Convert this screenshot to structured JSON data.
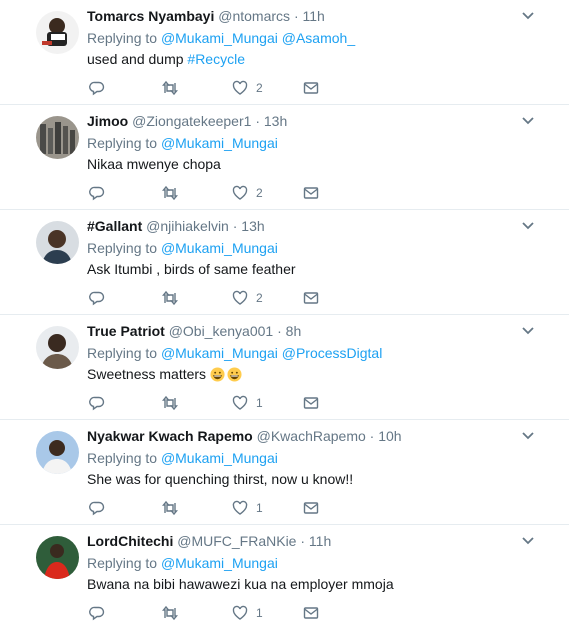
{
  "replying_to_label": "Replying to",
  "tweets": [
    {
      "name": "Tomarcs Nyambayi",
      "handle": "@ntomarcs",
      "time": "11h",
      "mentions": [
        "@Mukami_Mungai",
        "@Asamoh_"
      ],
      "text": "used and dump ",
      "hashtag": "#Recycle",
      "reply_count": "",
      "retweet_count": "",
      "like_count": "2"
    },
    {
      "name": "Jimoo",
      "handle": "@Ziongatekeeper1",
      "time": "13h",
      "mentions": [
        "@Mukami_Mungai"
      ],
      "text": "Nikaa mwenye chopa",
      "like_count": "2"
    },
    {
      "name": "#Gallant",
      "handle": "@njihiakelvin",
      "time": "13h",
      "mentions": [
        "@Mukami_Mungai"
      ],
      "text": "Ask Itumbi , birds of same feather",
      "like_count": "2"
    },
    {
      "name": "True Patriot",
      "handle": "@Obi_kenya001",
      "time": "8h",
      "mentions": [
        "@Mukami_Mungai",
        "@ProcessDigtal"
      ],
      "text": "Sweetness matters ",
      "emoji": "grinning-face-emoji",
      "like_count": "1"
    },
    {
      "name": "Nyakwar Kwach Rapemo",
      "handle": "@KwachRapemo",
      "time": "10h",
      "mentions": [
        "@Mukami_Mungai"
      ],
      "text": "She was for quenching thirst, now u know!!",
      "like_count": "1"
    },
    {
      "name": "LordChitechi",
      "handle": "@MUFC_FRaNKie",
      "time": "11h",
      "mentions": [
        "@Mukami_Mungai"
      ],
      "text": "Bwana na bibi hawawezi kua na employer mmoja",
      "like_count": "1"
    }
  ],
  "colors": {
    "link": "#1da1f2",
    "muted": "#657786",
    "text": "#14171a",
    "divider": "#e6ecf0"
  },
  "icons": {
    "reply": "reply-icon",
    "retweet": "retweet-icon",
    "like": "heart-icon",
    "dm": "envelope-icon",
    "menu": "chevron-down-icon"
  }
}
